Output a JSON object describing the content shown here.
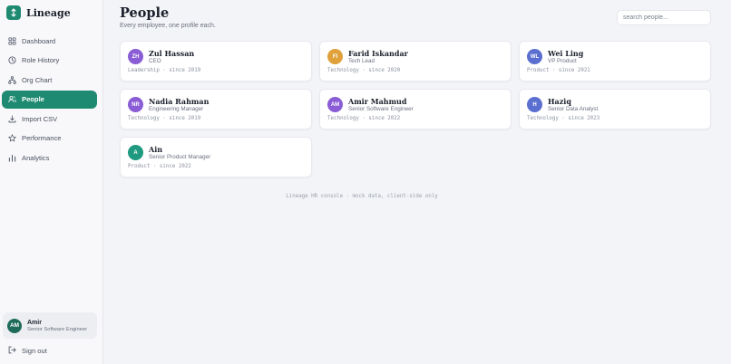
{
  "brand": {
    "name": "Lineage",
    "logo_icon": "arrows-updown-icon",
    "color": "#1f8a72"
  },
  "nav": {
    "items": [
      {
        "label": "Dashboard",
        "icon": "grid-icon",
        "active": false
      },
      {
        "label": "Role History",
        "icon": "clock-icon",
        "active": false
      },
      {
        "label": "Org Chart",
        "icon": "org-tree-icon",
        "active": false
      },
      {
        "label": "People",
        "icon": "users-icon",
        "active": true
      },
      {
        "label": "Import CSV",
        "icon": "download-icon",
        "active": false
      },
      {
        "label": "Performance",
        "icon": "star-icon",
        "active": false
      },
      {
        "label": "Analytics",
        "icon": "bar-chart-icon",
        "active": false
      }
    ]
  },
  "user": {
    "initials": "AM",
    "name": "Amir",
    "role": "Senior Software Engineer"
  },
  "signout_label": "Sign out",
  "page": {
    "title": "People",
    "subtitle": "Every employee, one profile each."
  },
  "search": {
    "placeholder": "search people...",
    "value": ""
  },
  "people": [
    {
      "initials": "ZH",
      "name": "Zul Hassan",
      "title": "CEO",
      "meta": "Leadership · since 2019",
      "color": "#8a5cd6"
    },
    {
      "initials": "FI",
      "name": "Farid Iskandar",
      "title": "Tech Lead",
      "meta": "Technology · since 2020",
      "color": "#e0a03a"
    },
    {
      "initials": "WL",
      "name": "Wei Ling",
      "title": "VP Product",
      "meta": "Product · since 2021",
      "color": "#5b6fd0"
    },
    {
      "initials": "NR",
      "name": "Nadia Rahman",
      "title": "Engineering Manager",
      "meta": "Technology · since 2019",
      "color": "#8a5cd6"
    },
    {
      "initials": "AM",
      "name": "Amir Mahmud",
      "title": "Senior Software Engineer",
      "meta": "Technology · since 2022",
      "color": "#8a5cd6"
    },
    {
      "initials": "H",
      "name": "Haziq",
      "title": "Senior Data Analyst",
      "meta": "Technology · since 2023",
      "color": "#5b6fd0"
    },
    {
      "initials": "A",
      "name": "Ain",
      "title": "Senior Product Manager",
      "meta": "Product · since 2022",
      "color": "#1f9a80"
    }
  ],
  "footer": "Lineage HR console · mock data, client-side only"
}
